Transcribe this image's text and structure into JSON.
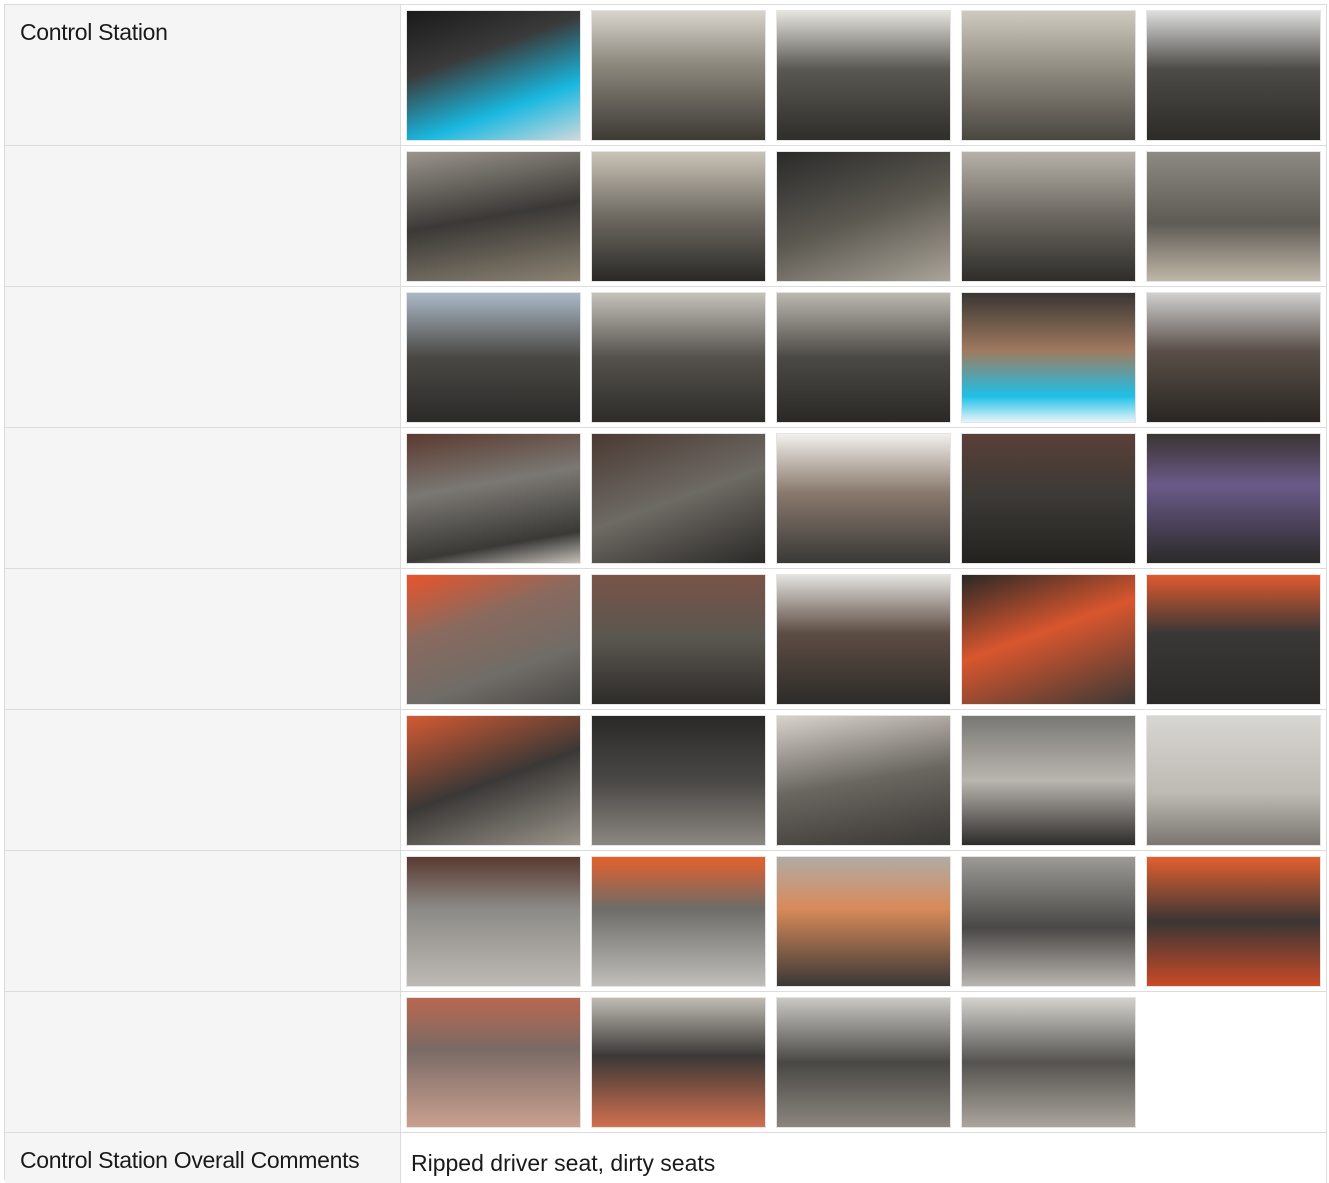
{
  "section": {
    "label": "Control Station",
    "comments_label": "Control Station Overall Comments",
    "comments_value": "Ripped driver seat, dirty seats"
  },
  "photo_rows": [
    [
      "interior-photo",
      "interior-photo",
      "interior-photo",
      "interior-photo",
      "interior-photo"
    ],
    [
      "interior-photo",
      "interior-photo",
      "interior-photo",
      "interior-photo",
      "interior-photo"
    ],
    [
      "interior-photo",
      "interior-photo",
      "interior-photo",
      "interior-photo",
      "interior-photo"
    ],
    [
      "interior-photo",
      "interior-photo",
      "interior-photo",
      "interior-photo",
      "interior-photo"
    ],
    [
      "interior-photo",
      "interior-photo",
      "interior-photo",
      "interior-photo",
      "interior-photo"
    ],
    [
      "interior-photo",
      "interior-photo",
      "interior-photo",
      "interior-photo",
      "interior-photo"
    ],
    [
      "interior-photo",
      "interior-photo",
      "interior-photo",
      "interior-photo",
      "interior-photo"
    ],
    [
      "interior-photo",
      "interior-photo",
      "interior-photo",
      "interior-photo"
    ]
  ]
}
